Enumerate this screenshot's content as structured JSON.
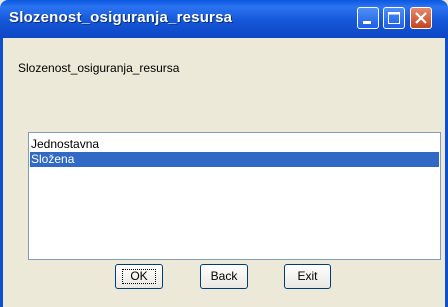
{
  "window": {
    "title": "Slozenost_osiguranja_resursa",
    "controls": {
      "minimize": "minimize-icon",
      "maximize": "maximize-icon",
      "close": "close-icon"
    }
  },
  "prompt": "Slozenost_osiguranja_resursa",
  "list": {
    "items": [
      "Jednostavna",
      "Složena"
    ],
    "selected": "Složena"
  },
  "buttons": {
    "ok": "OK",
    "back": "Back",
    "exit": "Exit"
  },
  "colors": {
    "titlebar": "#0e47c4",
    "selection": "#316ac5",
    "background": "#ece9d8"
  }
}
